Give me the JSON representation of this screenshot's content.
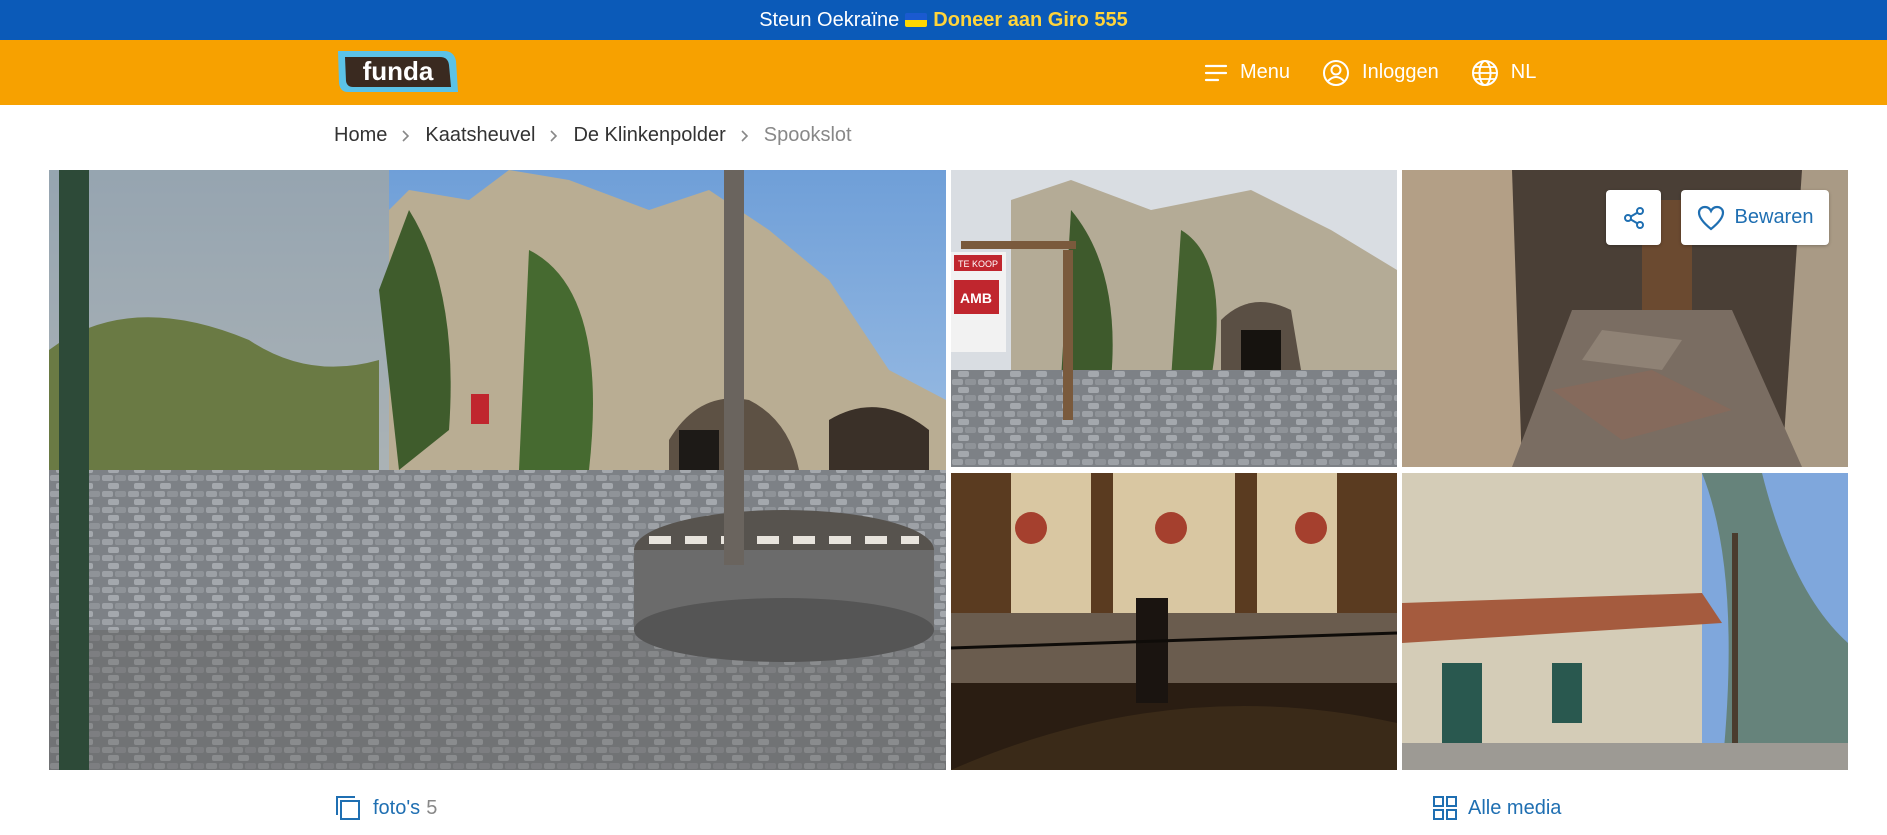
{
  "announcement": {
    "text": "Steun Oekraïne",
    "link": "Doneer aan Giro 555",
    "flag_icon": "ukraine-flag-icon"
  },
  "header": {
    "logo_text": "funda",
    "menu_label": "Menu",
    "login_label": "Inloggen",
    "language_label": "NL",
    "colors": {
      "bar": "#f7a100",
      "logo_blue": "#5bc2e7",
      "logo_dark": "#3a2a20"
    }
  },
  "breadcrumb": {
    "items": [
      "Home",
      "Kaatsheuvel",
      "De Klinkenpolder",
      "Spookslot"
    ]
  },
  "gallery": {
    "share_icon": "share-icon",
    "save_label": "Bewaren",
    "photos_label": "foto's",
    "photos_count": "5",
    "all_media_label": "Alle media",
    "sign_text": "AMB",
    "sign_sub": "TE KOOP"
  },
  "colors": {
    "topbar": "#0b5ab8",
    "link": "#1f6fb2",
    "donate": "#ffd43b"
  }
}
